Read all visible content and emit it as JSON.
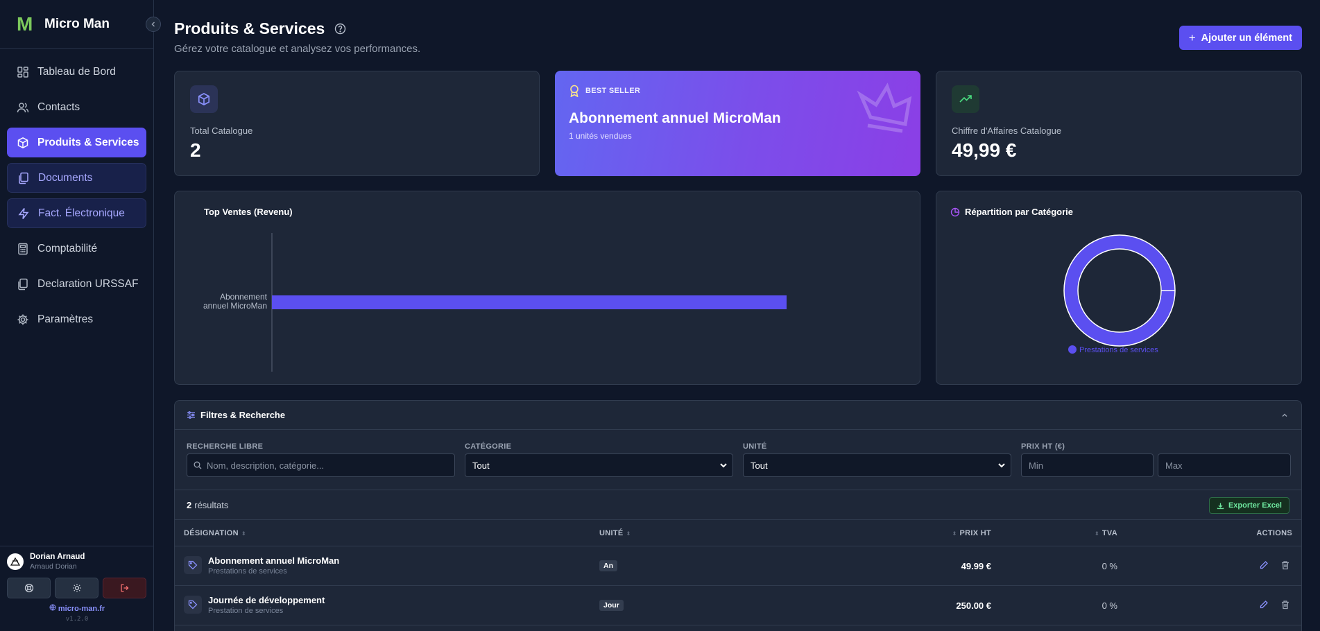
{
  "app": {
    "name": "Micro Man",
    "logo_letter": "M",
    "version": "v1.2.0",
    "site": "micro-man.fr"
  },
  "sidebar": {
    "items": [
      {
        "label": "Tableau de Bord",
        "icon": "dashboard-icon"
      },
      {
        "label": "Contacts",
        "icon": "users-icon"
      },
      {
        "label": "Produits & Services",
        "icon": "package-icon",
        "active": true
      },
      {
        "label": "Documents",
        "icon": "documents-icon"
      },
      {
        "label": "Fact. Électronique",
        "icon": "lightning-icon"
      },
      {
        "label": "Comptabilité",
        "icon": "calculator-icon"
      },
      {
        "label": "Declaration URSSAF",
        "icon": "copy-icon"
      },
      {
        "label": "Paramètres",
        "icon": "gear-icon"
      }
    ]
  },
  "user": {
    "name": "Dorian Arnaud",
    "sub": "Arnaud Dorian"
  },
  "header": {
    "title": "Produits & Services",
    "subtitle": "Gérez votre catalogue et analysez vos performances.",
    "add_button": "Ajouter un élément"
  },
  "kpis": {
    "total": {
      "label": "Total Catalogue",
      "value": "2"
    },
    "best": {
      "tag": "BEST SELLER",
      "name": "Abonnement annuel MicroMan",
      "sub": "1 unités vendues"
    },
    "revenue": {
      "label": "Chiffre d'Affaires Catalogue",
      "value": "49,99 €"
    }
  },
  "charts": {
    "top_sales_title": "Top Ventes (Revenu)",
    "category_title": "Répartition par Catégorie"
  },
  "chart_data": [
    {
      "type": "bar",
      "orientation": "horizontal",
      "title": "Top Ventes (Revenu)",
      "categories": [
        "Abonnement annuel MicroMan"
      ],
      "category_lines": [
        "Abonnement",
        "annuel MicroMan"
      ],
      "values": [
        49.99
      ],
      "color": "#5b4ff0"
    },
    {
      "type": "pie",
      "title": "Répartition par Catégorie",
      "donut": true,
      "slices": [
        {
          "name": "Prestations de services",
          "value": 100,
          "color": "#5b4ff0"
        }
      ],
      "legend": "bottom"
    }
  ],
  "filters": {
    "title": "Filtres & Recherche",
    "search_label": "RECHERCHE LIBRE",
    "search_placeholder": "Nom, description, catégorie...",
    "category_label": "CATÉGORIE",
    "category_value": "Tout",
    "unit_label": "UNITÉ",
    "unit_value": "Tout",
    "price_label": "PRIX HT (€)",
    "min_placeholder": "Min",
    "max_placeholder": "Max"
  },
  "results": {
    "count": "2",
    "label": "résultats",
    "export": "Exporter Excel"
  },
  "table": {
    "headers": {
      "designation": "DÉSIGNATION",
      "unit": "UNITÉ",
      "price": "PRIX HT",
      "tva": "TVA",
      "actions": "ACTIONS"
    },
    "rows": [
      {
        "name": "Abonnement annuel MicroMan",
        "category": "Prestations de services",
        "unit": "An",
        "price": "49.99 €",
        "tva": "0 %"
      },
      {
        "name": "Journée de développement",
        "category": "Prestation de services",
        "unit": "Jour",
        "price": "250.00 €",
        "tva": "0 %"
      }
    ]
  },
  "colors": {
    "accent": "#5b4ff0",
    "background": "#0f1729",
    "card": "#1e2738",
    "green": "#6ee79f"
  }
}
